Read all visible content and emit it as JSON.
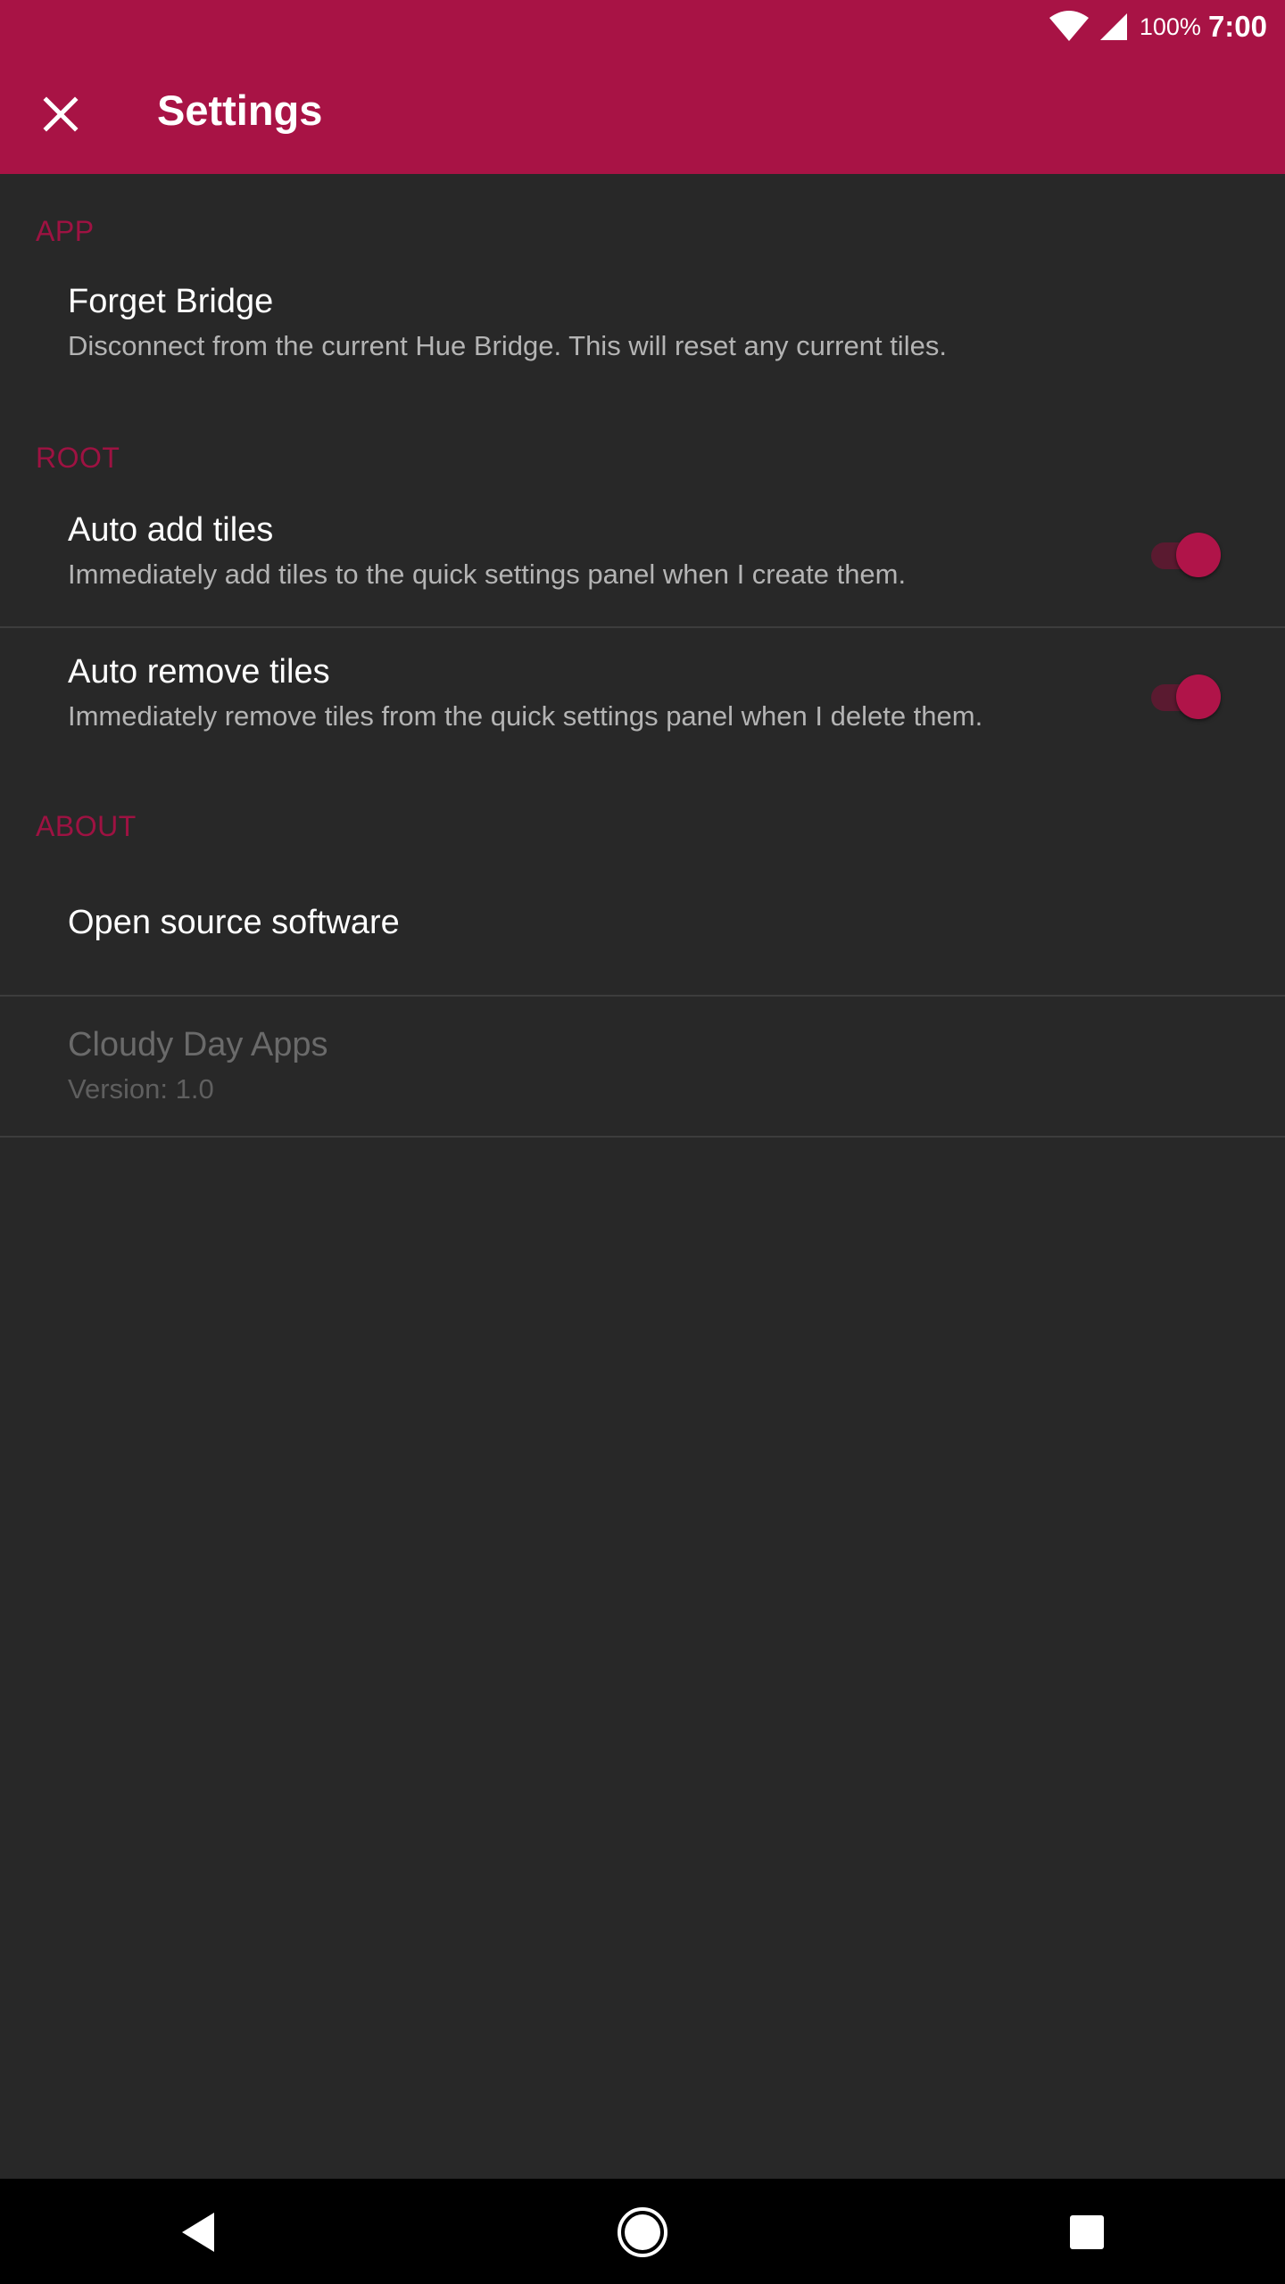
{
  "status_bar": {
    "battery": "100%",
    "time": "7:00",
    "icons": [
      "wifi-icon",
      "cell-signal-icon"
    ]
  },
  "app_bar": {
    "title": "Settings",
    "close_icon": "close-icon"
  },
  "sections": {
    "app": {
      "header": "APP",
      "forget_bridge": {
        "title": "Forget Bridge",
        "summary": "Disconnect from the current Hue Bridge. This will reset any current tiles."
      }
    },
    "root": {
      "header": "ROOT",
      "auto_add": {
        "title": "Auto add tiles",
        "summary": "Immediately add tiles to the quick settings panel when I create them.",
        "enabled": true
      },
      "auto_remove": {
        "title": "Auto remove tiles",
        "summary": "Immediately remove tiles from the quick settings panel when I delete them.",
        "enabled": true
      }
    },
    "about": {
      "header": "ABOUT",
      "open_source": {
        "title": "Open source software"
      },
      "developer": {
        "title": "Cloudy Day Apps",
        "summary": "Version: 1.0"
      }
    }
  },
  "colors": {
    "primary": "#a81345",
    "accent": "#b01449",
    "background": "#282828",
    "section_header": "#9e1242"
  },
  "nav_bar": {
    "icons": [
      "back-icon",
      "home-icon",
      "recents-icon"
    ]
  }
}
